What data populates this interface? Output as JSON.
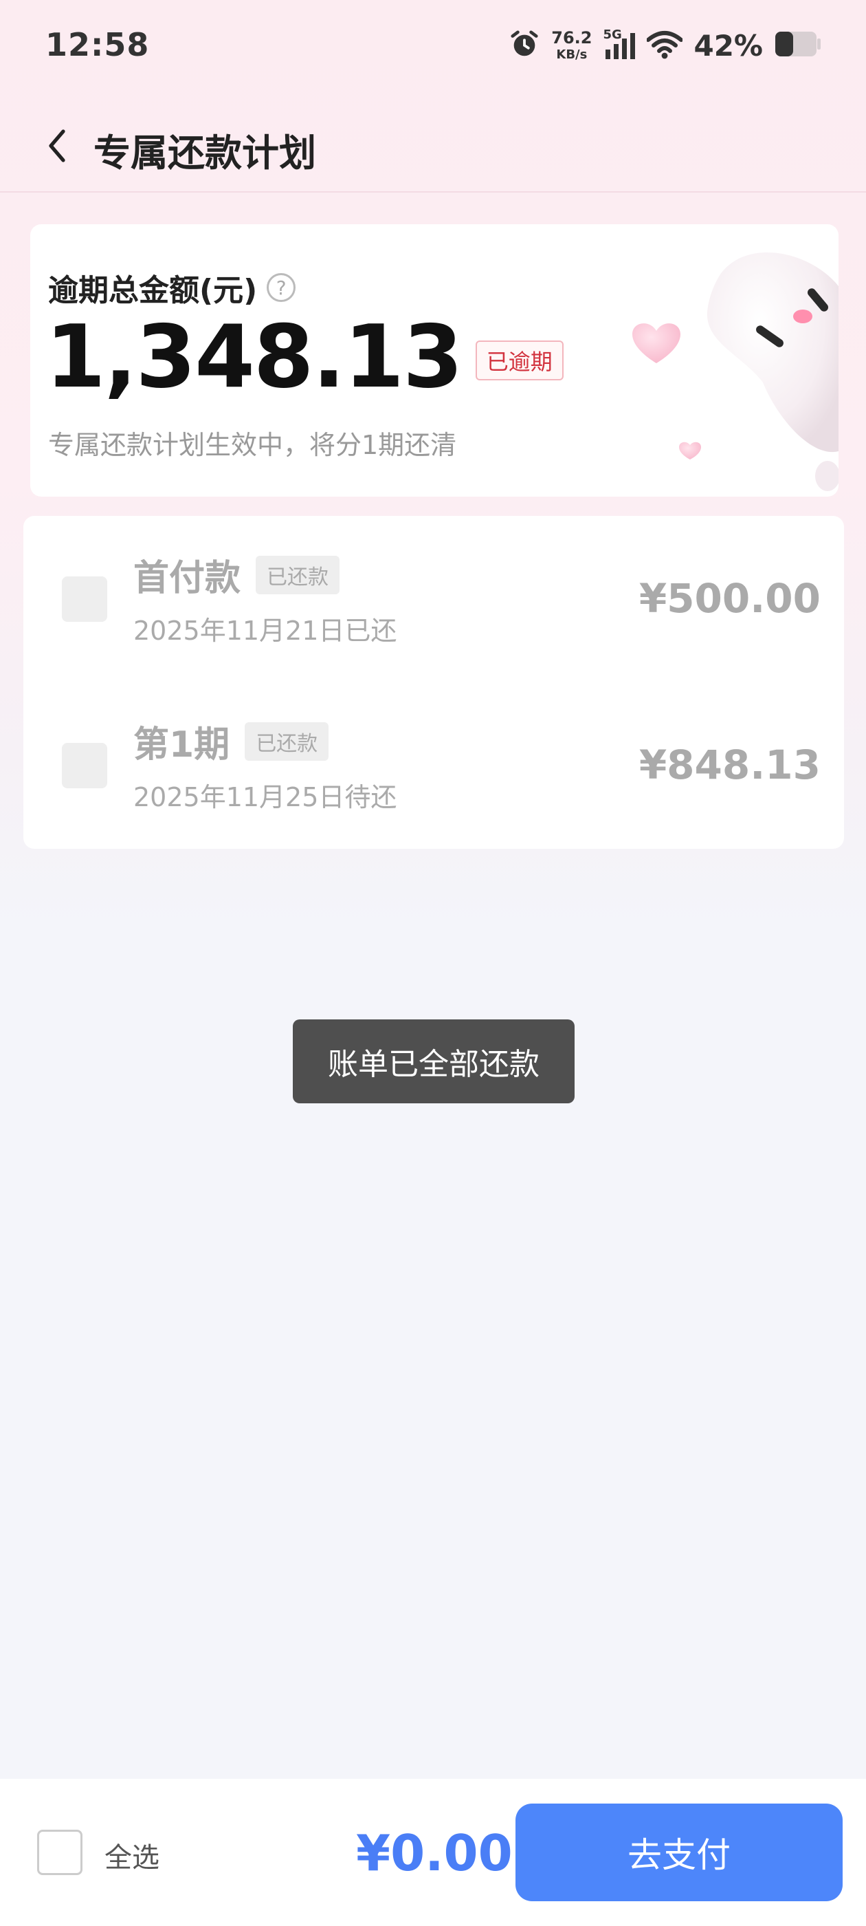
{
  "status_bar": {
    "time": "12:58",
    "net_speed_value": "76.2",
    "net_speed_unit": "KB/s",
    "network_type": "5G",
    "battery_percent": "42%"
  },
  "nav": {
    "title": "专属还款计划"
  },
  "summary": {
    "label": "逾期总金额(元)",
    "help_symbol": "?",
    "amount": "1,348.13",
    "overdue_badge": "已逾期",
    "note": "专属还款计划生效中，将分1期还清"
  },
  "installments": [
    {
      "name": "首付款",
      "tag": "已还款",
      "date": "2025年11月21日已还",
      "amount": "¥500.00"
    },
    {
      "name": "第1期",
      "tag": "已还款",
      "date": "2025年11月25日待还",
      "amount": "¥848.13"
    }
  ],
  "toast": {
    "message": "账单已全部还款"
  },
  "bottom": {
    "select_all_label": "全选",
    "total": "¥0.00",
    "pay_button_label": "去支付"
  },
  "colors": {
    "accent": "#4d86fa",
    "overdue": "#d2323e",
    "toast_bg": "#4f4f4f"
  }
}
